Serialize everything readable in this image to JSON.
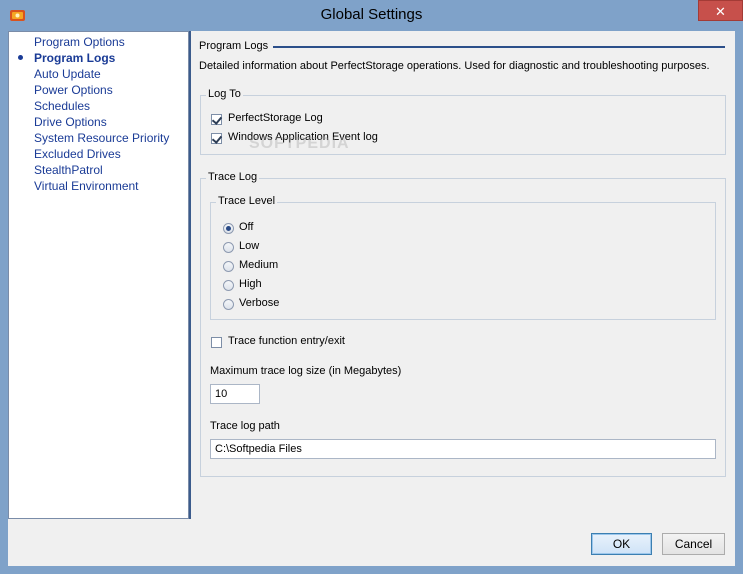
{
  "window": {
    "title": "Global Settings",
    "close_glyph": "✕"
  },
  "sidebar": {
    "items": [
      {
        "label": "Program Options",
        "active": false
      },
      {
        "label": "Program Logs",
        "active": true
      },
      {
        "label": "Auto Update",
        "active": false
      },
      {
        "label": "Power Options",
        "active": false
      },
      {
        "label": "Schedules",
        "active": false
      },
      {
        "label": "Drive Options",
        "active": false
      },
      {
        "label": "System Resource Priority",
        "active": false
      },
      {
        "label": "Excluded Drives",
        "active": false
      },
      {
        "label": "StealthPatrol",
        "active": false
      },
      {
        "label": "Virtual Environment",
        "active": false
      }
    ]
  },
  "main": {
    "section_title": "Program Logs",
    "description": "Detailed information about PerfectStorage operations. Used for diagnostic and troubleshooting purposes.",
    "log_to": {
      "label": "Log To",
      "perfectstorage_log": {
        "label": "PerfectStorage Log",
        "checked": true
      },
      "windows_event_log": {
        "label": "Windows Application Event log",
        "checked": true
      }
    },
    "trace_log": {
      "label": "Trace Log",
      "trace_level": {
        "label": "Trace Level",
        "options": [
          "Off",
          "Low",
          "Medium",
          "High",
          "Verbose"
        ],
        "selected": "Off"
      },
      "trace_function": {
        "label": "Trace function entry/exit",
        "checked": false
      },
      "max_size_label": "Maximum trace log size (in Megabytes)",
      "max_size_value": "10",
      "path_label": "Trace log path",
      "path_value": "C:\\Softpedia Files"
    }
  },
  "footer": {
    "ok_label": "OK",
    "cancel_label": "Cancel"
  },
  "watermark": "SOFTPEDIA",
  "colors": {
    "frame": "#7fa2c9",
    "accent": "#1a3b96",
    "close": "#c7504b"
  }
}
